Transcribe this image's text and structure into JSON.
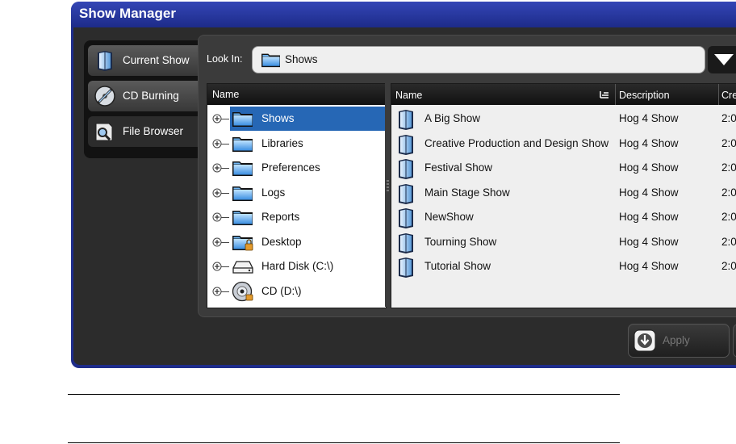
{
  "window": {
    "title": "Show Manager"
  },
  "tabs": [
    {
      "label": "Current Show",
      "icon": "show-book-icon"
    },
    {
      "label": "CD Burning",
      "icon": "cd-burn-icon"
    },
    {
      "label": "File Browser",
      "icon": "file-browser-icon",
      "active": true
    }
  ],
  "look_in": {
    "label": "Look In:",
    "value": "Shows"
  },
  "tree": {
    "header": "Name",
    "items": [
      {
        "label": "Shows",
        "icon": "folder-icon",
        "selected": true
      },
      {
        "label": "Libraries",
        "icon": "folder-icon"
      },
      {
        "label": "Preferences",
        "icon": "folder-icon"
      },
      {
        "label": "Logs",
        "icon": "folder-icon"
      },
      {
        "label": "Reports",
        "icon": "folder-icon"
      },
      {
        "label": "Desktop",
        "icon": "locked-folder-icon"
      },
      {
        "label": "Hard Disk (C:\\)",
        "icon": "hard-disk-icon"
      },
      {
        "label": "CD (D:\\)",
        "icon": "cd-drive-icon"
      }
    ]
  },
  "list": {
    "columns": [
      "Name",
      "Description",
      "Cre"
    ],
    "rows": [
      {
        "name": "A Big Show",
        "description": "Hog 4 Show",
        "created": "2:0"
      },
      {
        "name": "Creative Production and Design Show",
        "description": "Hog 4 Show",
        "created": "2:0"
      },
      {
        "name": "Festival Show",
        "description": "Hog 4 Show",
        "created": "2:0"
      },
      {
        "name": "Main Stage Show",
        "description": "Hog 4 Show",
        "created": "2:0"
      },
      {
        "name": "NewShow",
        "description": "Hog 4 Show",
        "created": "2:0"
      },
      {
        "name": "Tourning Show",
        "description": "Hog 4 Show",
        "created": "2:0"
      },
      {
        "name": "Tutorial Show",
        "description": "Hog 4 Show",
        "created": "2:0"
      }
    ]
  },
  "buttons": {
    "apply": "Apply"
  },
  "colors": {
    "title_bar": "#1e2c8a",
    "selection": "#2667b5",
    "panel": "#2c2c2c"
  }
}
